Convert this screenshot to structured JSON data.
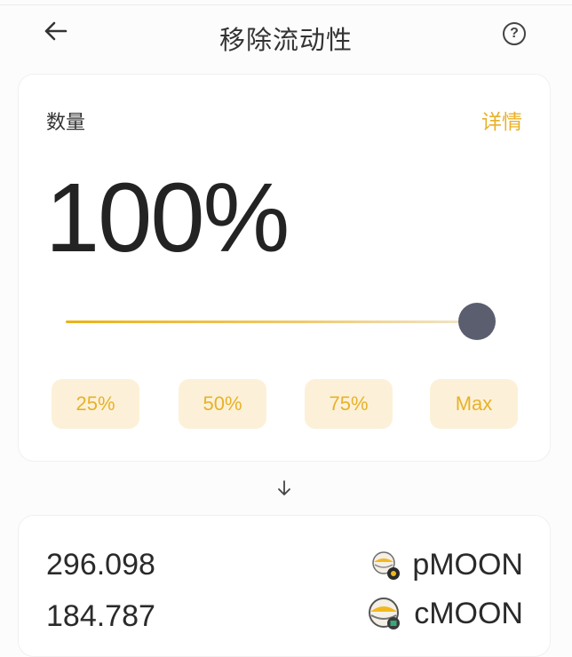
{
  "header": {
    "title": "移除流动性",
    "back_icon": "arrow-left-icon",
    "help_icon": "question-circle-icon",
    "help_glyph": "?"
  },
  "amount_card": {
    "label": "数量",
    "detail_link": "详情",
    "percent_display": "100%",
    "slider_value_percent": 100,
    "presets": [
      "25%",
      "50%",
      "75%",
      "Max"
    ]
  },
  "divider_icon": "arrow-down-icon",
  "receive_card": {
    "rows": [
      {
        "amount": "296.098",
        "token": "pMOON",
        "icon": "pmoon-token-icon"
      },
      {
        "amount": "184.787",
        "token": "cMOON",
        "icon": "cmoon-token-icon"
      }
    ]
  },
  "colors": {
    "accent": "#e8b12a",
    "chip_bg": "#fcf1d8",
    "thumb": "#5a5e6f",
    "text": "#222222"
  }
}
